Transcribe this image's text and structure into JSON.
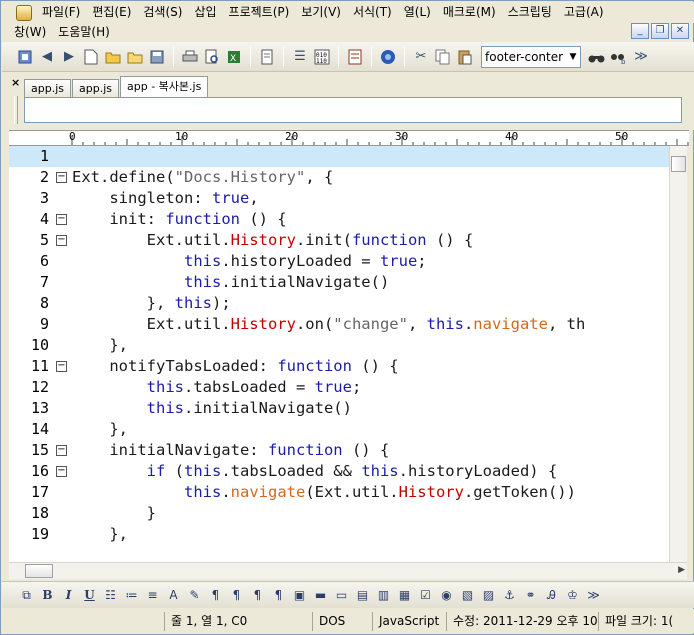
{
  "menu": {
    "items": [
      "파일(F)",
      "편집(E)",
      "검색(S)",
      "삽입",
      "프로젝트(P)",
      "보기(V)",
      "서식(T)",
      "열(L)",
      "매크로(M)",
      "스크립팅",
      "고급(A)"
    ],
    "items2": [
      "창(W)",
      "도움말(H)"
    ]
  },
  "window_buttons": {
    "minimize": "_",
    "restore": "❐",
    "close": "✕"
  },
  "toolbar": {
    "combo_value": "footer-conter",
    "more": "≫"
  },
  "tabs": {
    "close_label": "×",
    "items": [
      {
        "label": "app.js"
      },
      {
        "label": "app.js"
      },
      {
        "label": "app - 복사본.js"
      }
    ]
  },
  "ruler": {
    "labels": [
      "0",
      "10",
      "20",
      "30",
      "40",
      "50"
    ]
  },
  "editor": {
    "lines": [
      {
        "n": "1",
        "fold": false,
        "html": ""
      },
      {
        "n": "2",
        "fold": true,
        "html": "<span class='t-tx'>Ext.define(</span><span class='t-str'>\"Docs.History\"</span><span class='t-tx'>, {</span>"
      },
      {
        "n": "3",
        "fold": false,
        "html": "<span class='t-tx'>    singleton: </span><span class='t-kw'>true</span><span class='t-tx'>,</span>"
      },
      {
        "n": "4",
        "fold": true,
        "html": "<span class='t-tx'>    init: </span><span class='t-kw'>function</span><span class='t-tx'> () {</span>"
      },
      {
        "n": "5",
        "fold": true,
        "html": "<span class='t-tx'>        Ext.util.</span><span class='t-obj'>History</span><span class='t-tx'>.init(</span><span class='t-kw'>function</span><span class='t-tx'> () {</span>"
      },
      {
        "n": "6",
        "fold": false,
        "html": "<span class='t-tx'>            </span><span class='t-kw'>this</span><span class='t-tx'>.historyLoaded = </span><span class='t-kw'>true</span><span class='t-tx'>;</span>"
      },
      {
        "n": "7",
        "fold": false,
        "html": "<span class='t-tx'>            </span><span class='t-kw'>this</span><span class='t-tx'>.initialNavigate()</span>"
      },
      {
        "n": "8",
        "fold": false,
        "html": "<span class='t-tx'>        }, </span><span class='t-kw'>this</span><span class='t-tx'>);</span>"
      },
      {
        "n": "9",
        "fold": false,
        "html": "<span class='t-tx'>        Ext.util.</span><span class='t-obj'>History</span><span class='t-tx'>.on(</span><span class='t-str'>\"change\"</span><span class='t-tx'>, </span><span class='t-kw'>this</span><span class='t-tx'>.</span><span class='t-nav'>navigate</span><span class='t-tx'>, th</span>"
      },
      {
        "n": "10",
        "fold": false,
        "html": "<span class='t-tx'>    },</span>"
      },
      {
        "n": "11",
        "fold": true,
        "html": "<span class='t-tx'>    notifyTabsLoaded: </span><span class='t-kw'>function</span><span class='t-tx'> () {</span>"
      },
      {
        "n": "12",
        "fold": false,
        "html": "<span class='t-tx'>        </span><span class='t-kw'>this</span><span class='t-tx'>.tabsLoaded = </span><span class='t-kw'>true</span><span class='t-tx'>;</span>"
      },
      {
        "n": "13",
        "fold": false,
        "html": "<span class='t-tx'>        </span><span class='t-kw'>this</span><span class='t-tx'>.initialNavigate()</span>"
      },
      {
        "n": "14",
        "fold": false,
        "html": "<span class='t-tx'>    },</span>"
      },
      {
        "n": "15",
        "fold": true,
        "html": "<span class='t-tx'>    initialNavigate: </span><span class='t-kw'>function</span><span class='t-tx'> () {</span>"
      },
      {
        "n": "16",
        "fold": true,
        "html": "<span class='t-tx'>        </span><span class='t-kw'>if</span><span class='t-tx'> (</span><span class='t-kw'>this</span><span class='t-tx'>.tabsLoaded &amp;&amp; </span><span class='t-kw'>this</span><span class='t-tx'>.historyLoaded) {</span>"
      },
      {
        "n": "17",
        "fold": false,
        "html": "<span class='t-tx'>            </span><span class='t-kw'>this</span><span class='t-tx'>.</span><span class='t-nav'>navigate</span><span class='t-tx'>(Ext.util.</span><span class='t-obj'>History</span><span class='t-tx'>.getToken())</span>"
      },
      {
        "n": "18",
        "fold": false,
        "html": "<span class='t-tx'>        }</span>"
      },
      {
        "n": "19",
        "fold": false,
        "html": "<span class='t-tx'>    },</span>"
      }
    ]
  },
  "status": {
    "position": "줄 1, 열 1, C0",
    "line_ending": "DOS",
    "language": "JavaScript",
    "modified": "수정: 2011-12-29 오후 10:",
    "file_size": "파일 크기: 1("
  },
  "colors": {
    "keyword": "#1c1ca8",
    "string": "#666666",
    "object": "#c00000",
    "method": "#d2691e",
    "current_line": "#cde8f8"
  }
}
